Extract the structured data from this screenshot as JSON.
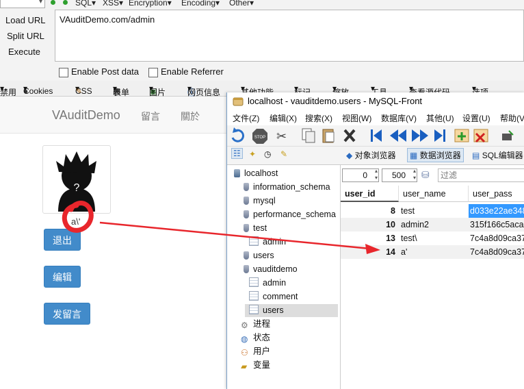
{
  "hackbar": {
    "menus": [
      "SQL",
      "XSS",
      "Encryption",
      "Encoding",
      "Other"
    ],
    "buttons": [
      "Load URL",
      "Split URL",
      "Execute"
    ],
    "url": "VAuditDemo.com/admin",
    "checkboxes": [
      "Enable Post data",
      "Enable Referrer"
    ]
  },
  "bookmarks": [
    "禁用",
    "Cookies",
    "CSS",
    "表单",
    "图片",
    "网页信息",
    "其他功能",
    "标记",
    "缩放",
    "工具",
    "查看源代码",
    "选项"
  ],
  "page": {
    "brand": "VAuditDemo",
    "nav": [
      "留言",
      "關於"
    ],
    "username": "a\\'",
    "buttons": [
      "退出",
      "编辑",
      "发留言"
    ]
  },
  "mysqlfront": {
    "title": "localhost - vauditdemo.users - MySQL-Front",
    "menu": [
      "文件(Z)",
      "编辑(X)",
      "搜索(X)",
      "视图(W)",
      "数据库(V)",
      "其他(U)",
      "设置(U)",
      "帮助(V"
    ],
    "tabs": [
      "对象浏览器",
      "数据浏览器",
      "SQL编辑器"
    ],
    "tree": {
      "host": "localhost",
      "databases": [
        {
          "name": "information_schema"
        },
        {
          "name": "mysql"
        },
        {
          "name": "performance_schema"
        },
        {
          "name": "test",
          "tables": [
            "admin"
          ]
        },
        {
          "name": "users"
        },
        {
          "name": "vauditdemo",
          "tables": [
            "admin",
            "comment",
            "users"
          ]
        }
      ],
      "extras": [
        "进程",
        "状态",
        "用户",
        "变量"
      ]
    },
    "grid": {
      "offset": "0",
      "limit": "500",
      "filter_placeholder": "过滤",
      "columns": [
        "user_id",
        "user_name",
        "user_pass"
      ],
      "rows": [
        {
          "user_id": "8",
          "user_name": "test",
          "user_pass": "d033e22ae348"
        },
        {
          "user_id": "10",
          "user_name": "admin2",
          "user_pass": "315f166c5aca"
        },
        {
          "user_id": "13",
          "user_name": "test\\",
          "user_pass": "7c4a8d09ca37"
        },
        {
          "user_id": "14",
          "user_name": "a'",
          "user_pass": "7c4a8d09ca37"
        }
      ]
    }
  },
  "colors": {
    "primary_button": "#428bca",
    "annotation": "#e8262c",
    "selected_cell": "#3399ff"
  }
}
